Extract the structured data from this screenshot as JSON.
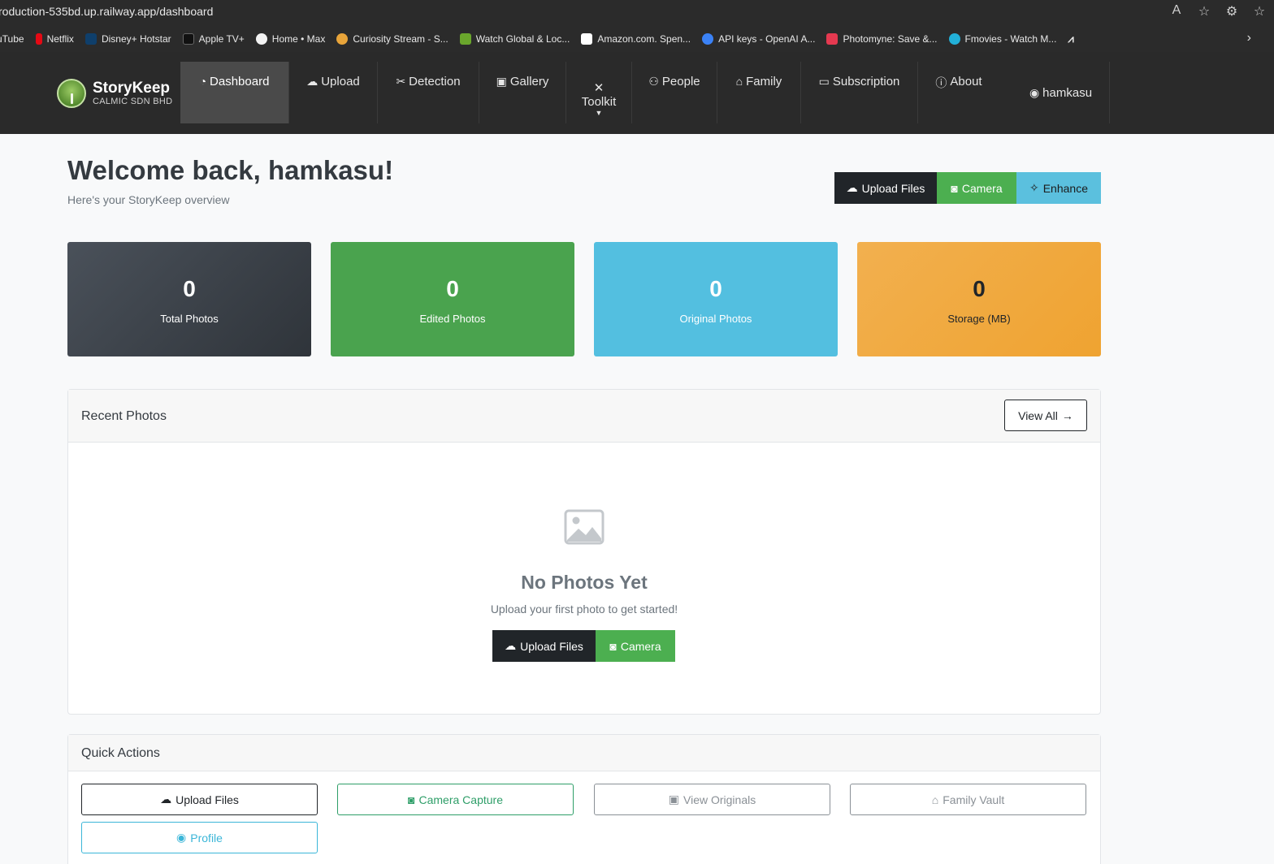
{
  "browser": {
    "url": "roduction-535bd.up.railway.app/dashboard",
    "bookmarks": [
      {
        "label": "uTube",
        "icon": "youtube-icon",
        "color": "#2b2b2b"
      },
      {
        "label": "Netflix",
        "icon": "netflix-icon",
        "color": "#e50914"
      },
      {
        "label": "Disney+ Hotstar",
        "icon": "hotstar-icon",
        "color": "#0f3f6b"
      },
      {
        "label": "Apple TV+",
        "icon": "appletv-icon",
        "color": "#111111"
      },
      {
        "label": "Home • Max",
        "icon": "max-icon",
        "color": "#f2f2f2"
      },
      {
        "label": "Curiosity Stream - S...",
        "icon": "curiosity-icon",
        "color": "#e8a43a"
      },
      {
        "label": "Watch Global & Loc...",
        "icon": "tv-icon",
        "color": "#6aa62c"
      },
      {
        "label": "Amazon.com. Spen...",
        "icon": "amazon-icon",
        "color": "#ffffff"
      },
      {
        "label": "API keys - OpenAI A...",
        "icon": "openai-icon",
        "color": "#3b82f6"
      },
      {
        "label": "Photomyne: Save &...",
        "icon": "photomyne-icon",
        "color": "#e53950"
      },
      {
        "label": "Fmovies - Watch M...",
        "icon": "fmovies-icon",
        "color": "#22b0d8"
      }
    ]
  },
  "nav": {
    "brand_name": "StoryKeep",
    "brand_sub": "CALMIC SDN BHD",
    "items": [
      {
        "label": "Dashboard",
        "icon": "speedometer-icon"
      },
      {
        "label": "Upload",
        "icon": "cloud-upload-icon"
      },
      {
        "label": "Detection",
        "icon": "scissors-icon"
      },
      {
        "label": "Gallery",
        "icon": "images-icon"
      },
      {
        "label": "Toolkit",
        "icon": "tools-icon"
      },
      {
        "label": "People",
        "icon": "people-icon"
      },
      {
        "label": "Family",
        "icon": "house-heart-icon"
      },
      {
        "label": "Subscription",
        "icon": "credit-card-icon"
      },
      {
        "label": "About",
        "icon": "info-icon"
      }
    ],
    "user": "hamkasu"
  },
  "header": {
    "title": "Welcome back, hamkasu!",
    "subtitle": "Here's your StoryKeep overview",
    "upload_label": "Upload Files",
    "camera_label": "Camera",
    "enhance_label": "Enhance"
  },
  "stats": [
    {
      "value": "0",
      "label": "Total Photos"
    },
    {
      "value": "0",
      "label": "Edited Photos"
    },
    {
      "value": "0",
      "label": "Original Photos"
    },
    {
      "value": "0",
      "label": "Storage (MB)"
    }
  ],
  "recent": {
    "title": "Recent Photos",
    "view_all": "View All",
    "empty_title": "No Photos Yet",
    "empty_sub": "Upload your first photo to get started!",
    "upload_label": "Upload Files",
    "camera_label": "Camera"
  },
  "quick_actions": {
    "title": "Quick Actions",
    "items": [
      {
        "label": "Upload Files",
        "icon": "cloud-upload-icon"
      },
      {
        "label": "Camera Capture",
        "icon": "camera-icon"
      },
      {
        "label": "View Originals",
        "icon": "image-icon"
      },
      {
        "label": "Family Vault",
        "icon": "house-heart-icon"
      },
      {
        "label": "Profile",
        "icon": "person-circle-icon"
      }
    ]
  },
  "colors": {
    "navbar": "#2a2a2a",
    "dark": "#212529",
    "success": "#4caf50",
    "info": "#5bc0de",
    "warning": "#efa331"
  }
}
